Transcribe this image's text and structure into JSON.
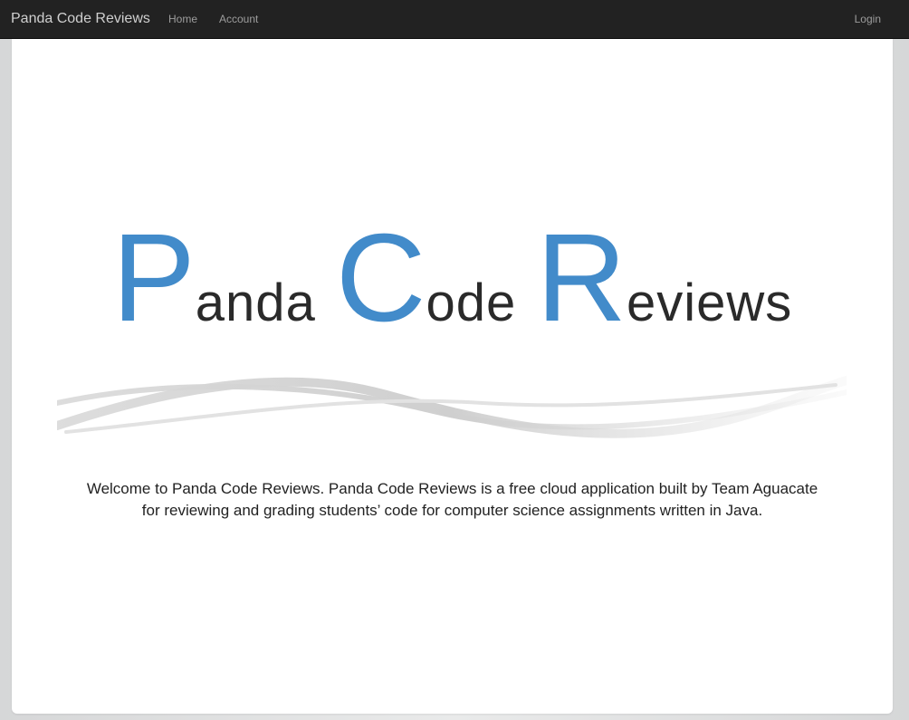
{
  "navbar": {
    "brand": "Panda Code Reviews",
    "links": {
      "home": "Home",
      "account": "Account",
      "login": "Login"
    }
  },
  "logo": {
    "words": [
      {
        "initial": "P",
        "rest": "anda"
      },
      {
        "initial": "C",
        "rest": "ode"
      },
      {
        "initial": "R",
        "rest": "eviews"
      }
    ]
  },
  "welcome": {
    "line1": "Welcome to Panda Code Reviews. Panda Code Reviews is a free cloud application built by Team Aguacate",
    "line2": "for reviewing and grading students’ code for computer science assignments written in Java."
  },
  "colors": {
    "navbar_bg": "#222222",
    "accent": "#428bca",
    "text": "#2a2a2a"
  }
}
